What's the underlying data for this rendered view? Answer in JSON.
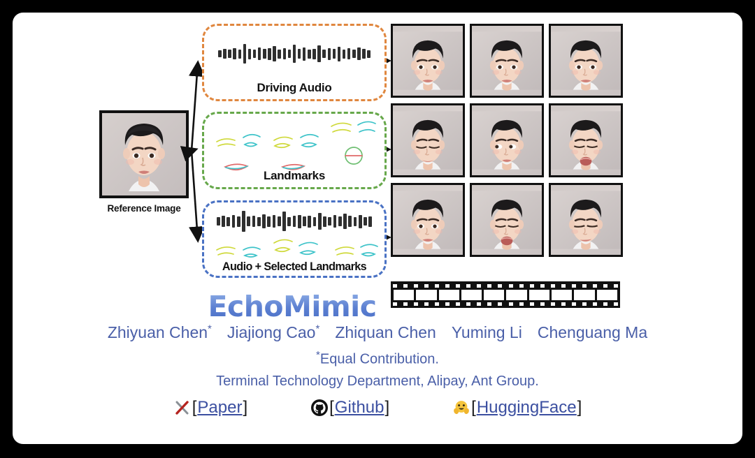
{
  "page": {
    "background_color": "#000000",
    "card_color": "#ffffff"
  },
  "diagram": {
    "reference": {
      "label": "Reference Image",
      "icon": "portrait-photo"
    },
    "modalities": [
      {
        "id": "audio",
        "label": "Driving Audio",
        "border_color": "#e0873f",
        "contents": [
          "audio-waveform"
        ]
      },
      {
        "id": "landmarks",
        "label": "Landmarks",
        "border_color": "#67a84b",
        "contents": [
          "facial-landmarks"
        ]
      },
      {
        "id": "audio-landmarks",
        "label": "Audio + Selected Landmarks",
        "border_color": "#4a72c4",
        "contents": [
          "audio-waveform",
          "facial-landmarks"
        ]
      }
    ],
    "outputs": {
      "rows": [
        {
          "modality": "audio",
          "frames": [
            "neutral",
            "neutral",
            "neutral"
          ]
        },
        {
          "modality": "landmarks",
          "frames": [
            "eyes-closed",
            "looking-left",
            "mouth-open"
          ]
        },
        {
          "modality": "audio-landmarks",
          "frames": [
            "neutral",
            "mouth-open",
            "eyes-squint"
          ]
        }
      ]
    },
    "film_strip": {
      "frames": 10,
      "icon": "film-strip"
    },
    "logo": {
      "text": "EchoMimic",
      "color": "#5b7fd1"
    },
    "waveform_bars": [
      10,
      14,
      12,
      16,
      13,
      28,
      15,
      12,
      18,
      14,
      17,
      22,
      13,
      16,
      12,
      26,
      14,
      19,
      13,
      15,
      24,
      12,
      17,
      14,
      21,
      13,
      16,
      12,
      18,
      14,
      11
    ],
    "waveform_bars_b": [
      12,
      16,
      13,
      18,
      15,
      30,
      14,
      16,
      13,
      20,
      15,
      18,
      14,
      28,
      13,
      16,
      19,
      14,
      17,
      13,
      24,
      15,
      12,
      18,
      14,
      22,
      16,
      13,
      19,
      12,
      15
    ]
  },
  "authors": {
    "names": [
      "Zhiyuan Chen",
      "Jiajiong Cao",
      "Zhiquan Chen",
      "Yuming Li",
      "Chenguang Ma"
    ],
    "starred": [
      "Zhiyuan Chen",
      "Jiajiong Cao"
    ],
    "star": "*",
    "equal_contribution": "Equal Contribution.",
    "affiliation": "Terminal Technology Department, Alipay, Ant Group.",
    "color": "#4a5fa8"
  },
  "links": [
    {
      "icon": "arxiv-icon",
      "label": "[Paper]",
      "bracket_open": "[",
      "text": "Paper",
      "bracket_close": "]"
    },
    {
      "icon": "github-icon",
      "label": "[Github]",
      "bracket_open": "[",
      "text": "Github",
      "bracket_close": "]"
    },
    {
      "icon": "huggingface-icon",
      "label": "[HuggingFace]",
      "bracket_open": "[",
      "text": "HuggingFace",
      "bracket_close": "]"
    }
  ]
}
